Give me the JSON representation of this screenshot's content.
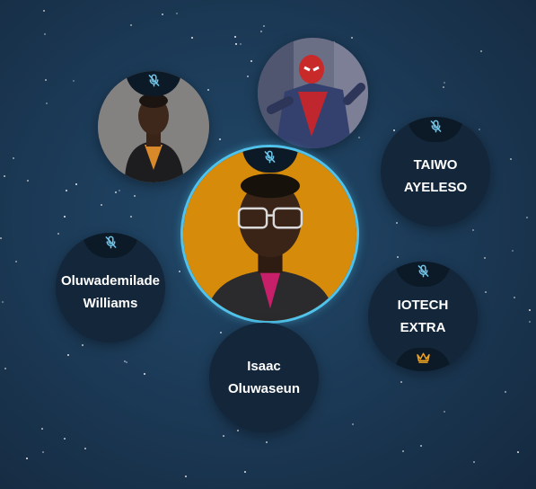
{
  "participants": [
    {
      "id": "p1",
      "name": "",
      "muted": true,
      "has_photo": true
    },
    {
      "id": "p2",
      "name": "",
      "muted": false,
      "has_photo": true
    },
    {
      "id": "p3",
      "name": "TAIWO\nAYELESO",
      "muted": true
    },
    {
      "id": "p4",
      "name": "",
      "muted": true,
      "has_photo": true,
      "speaking": true
    },
    {
      "id": "p5",
      "name": "Oluwademilade\nWilliams",
      "muted": true
    },
    {
      "id": "p6",
      "name": "IOTECH\nEXTRA",
      "muted": true,
      "host": true
    },
    {
      "id": "p7",
      "name": "Isaac\nOluwaseun",
      "muted": false
    }
  ],
  "icons": {
    "muted": "mic-off-icon",
    "host": "crown-icon"
  },
  "colors": {
    "background": "#1c3b58",
    "bubble": "#13263a",
    "mic_cap": "#0c1a28",
    "mic_icon": "#6fc7ea",
    "speaking_ring": "#4fc3ec",
    "crown": "#f0a31f"
  }
}
